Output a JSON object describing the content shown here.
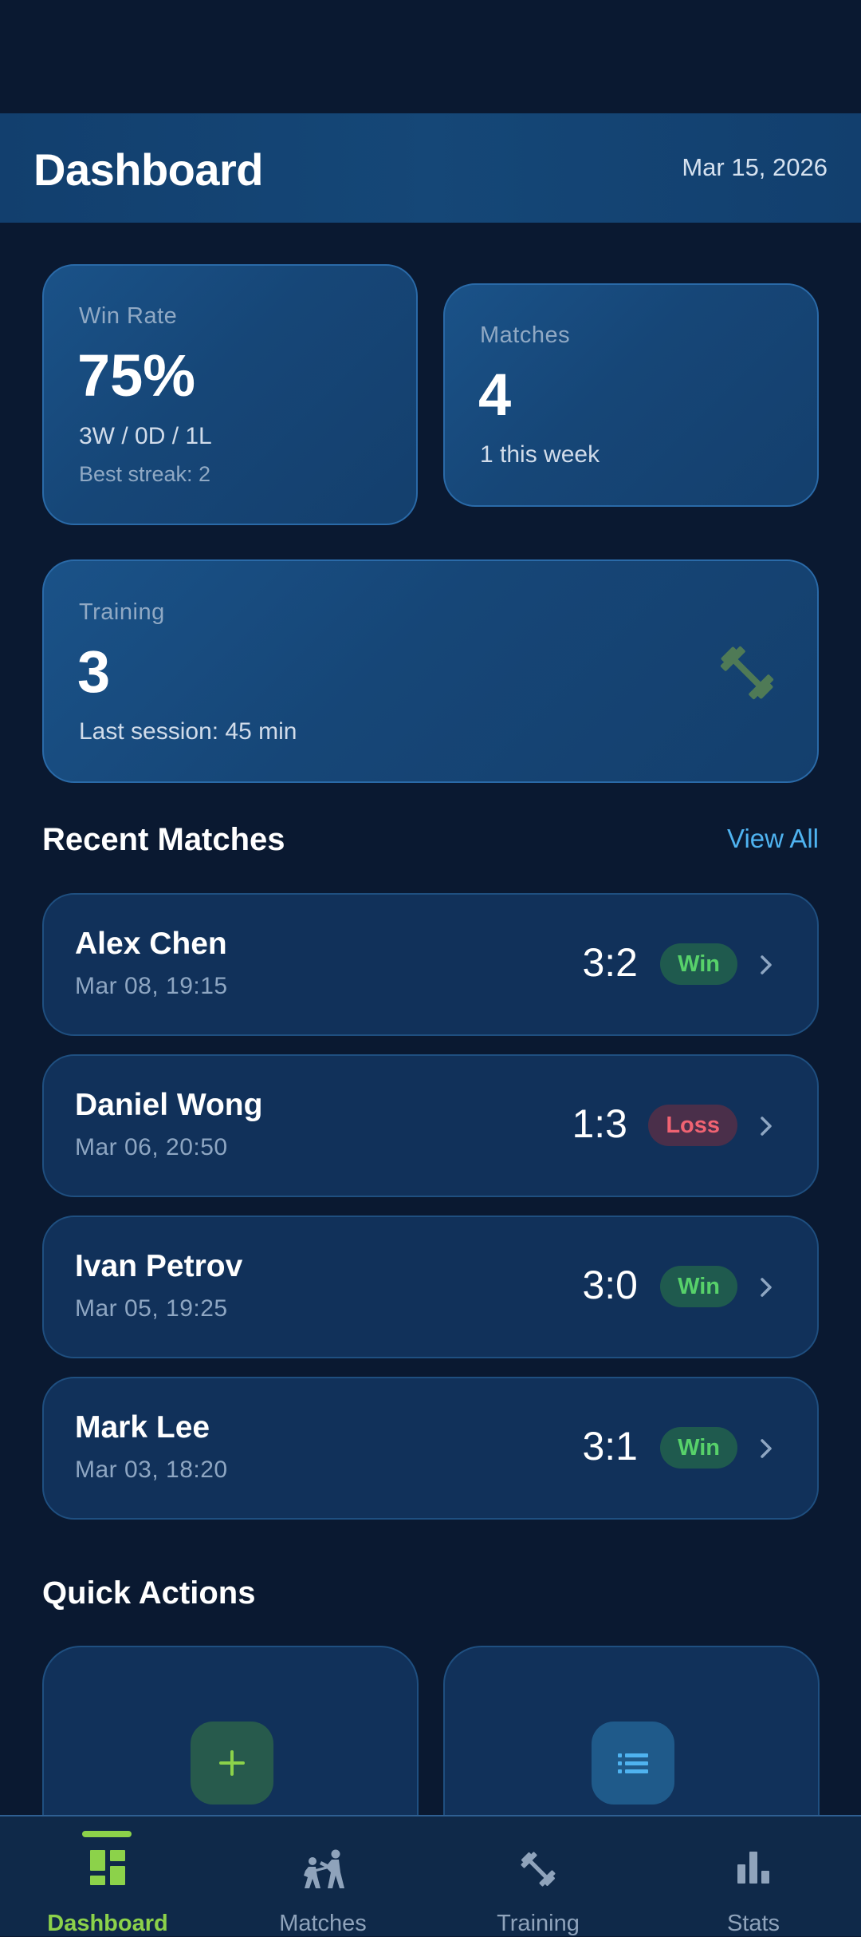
{
  "header": {
    "title": "Dashboard",
    "date": "Mar 15, 2026"
  },
  "stats": {
    "win_rate": {
      "label": "Win Rate",
      "value": "75%",
      "record": "3W / 0D / 1L",
      "streak": "Best streak: 2"
    },
    "matches": {
      "label": "Matches",
      "value": "4",
      "sub": "1 this week"
    },
    "training": {
      "label": "Training",
      "value": "3",
      "sub": "Last session: 45 min",
      "icon": "dumbbell-icon"
    }
  },
  "recent": {
    "title": "Recent Matches",
    "view_all": "View All",
    "items": [
      {
        "name": "Alex Chen",
        "when": "Mar 08, 19:15",
        "score": "3:2",
        "result": "Win"
      },
      {
        "name": "Daniel Wong",
        "when": "Mar 06, 20:50",
        "score": "1:3",
        "result": "Loss"
      },
      {
        "name": "Ivan Petrov",
        "when": "Mar 05, 19:25",
        "score": "3:0",
        "result": "Win"
      },
      {
        "name": "Mark Lee",
        "when": "Mar 03, 18:20",
        "score": "3:1",
        "result": "Win"
      }
    ]
  },
  "quick_actions": {
    "title": "Quick Actions",
    "icons": [
      "plus-icon",
      "list-icon"
    ]
  },
  "nav": {
    "items": [
      {
        "label": "Dashboard",
        "icon": "dashboard-icon",
        "active": true
      },
      {
        "label": "Matches",
        "icon": "fencing-icon",
        "active": false
      },
      {
        "label": "Training",
        "icon": "dumbbell-icon",
        "active": false
      },
      {
        "label": "Stats",
        "icon": "bar-chart-icon",
        "active": false
      }
    ]
  },
  "colors": {
    "background": "#0a1931",
    "accent_green": "#8cd24a",
    "accent_blue": "#4fb3f0",
    "win": "#57d16a",
    "loss": "#f06372"
  }
}
